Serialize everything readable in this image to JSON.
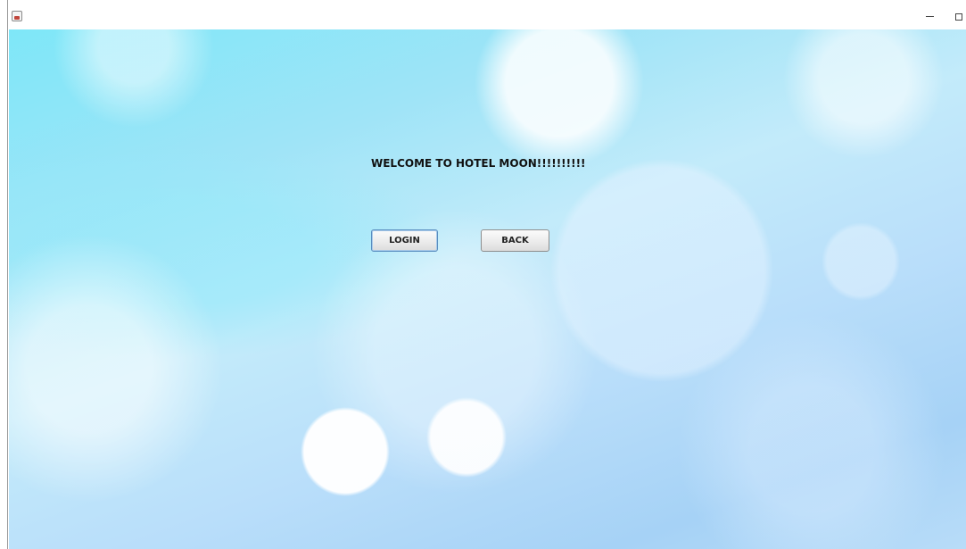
{
  "window": {
    "title": "",
    "controls": {
      "minimize": "minimize",
      "maximize": "maximize",
      "close": "×"
    }
  },
  "main": {
    "welcome_text": "WELCOME TO HOTEL MOON!!!!!!!!!!",
    "login_label": "LOGIN",
    "back_label": "BACK"
  },
  "icons": {
    "app": "java-app-icon",
    "minimize": "minimize-icon",
    "maximize": "maximize-icon",
    "close": "close-icon"
  }
}
